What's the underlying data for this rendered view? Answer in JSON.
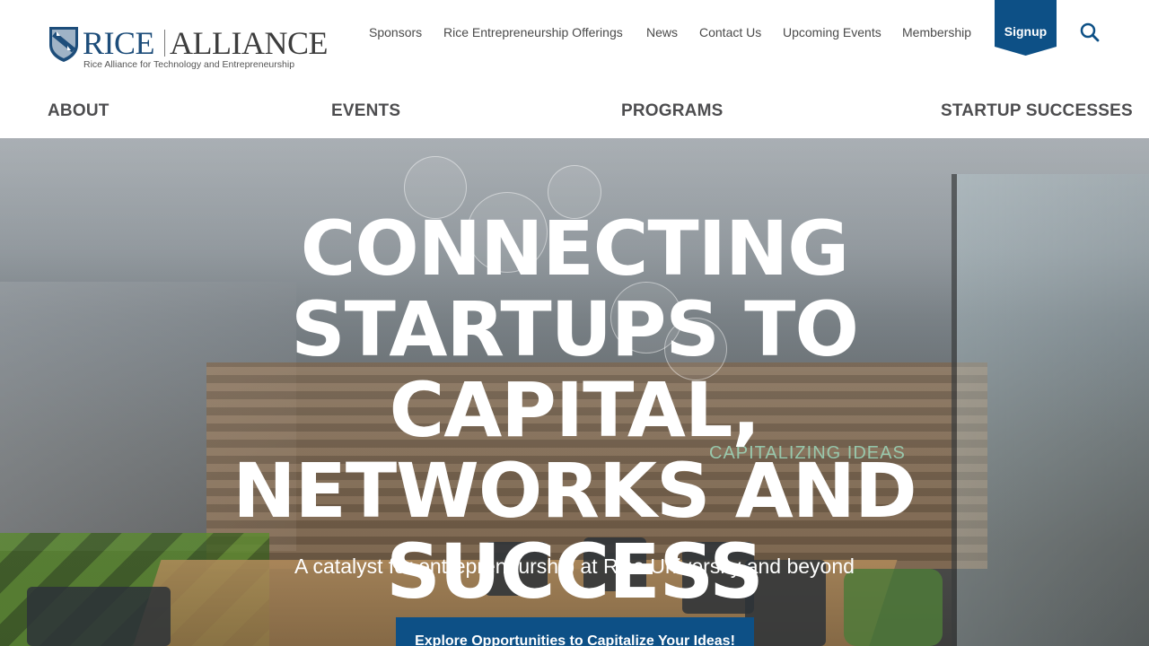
{
  "brand": {
    "name_part1": "RICE",
    "name_part2": "ALLIANCE",
    "tagline": "Rice Alliance for Technology and Entrepreneurship"
  },
  "utility_nav": {
    "items": [
      "Sponsors",
      "Rice Entrepreneurship Offerings",
      "News",
      "Contact Us",
      "Upcoming Events",
      "Membership"
    ],
    "signup_label": "Signup"
  },
  "main_nav": {
    "items": [
      "ABOUT",
      "EVENTS",
      "PROGRAMS",
      "STARTUP SUCCESSES"
    ]
  },
  "hero": {
    "title_lines": [
      "CONNECTING",
      "STARTUPS TO CAPITAL,",
      "NETWORKS AND",
      "SUCCESS"
    ],
    "subtitle": "A catalyst for entrepreneurship at Rice University and beyond",
    "cta_label": "Explore Opportunities to Capitalize Your Ideas!",
    "background_sign": "CAPITALIZING IDEAS"
  },
  "colors": {
    "brand_blue": "#0d5086",
    "nav_text": "#4d4d4f",
    "logo_blue": "#1d4d7a"
  },
  "icons": {
    "search": "search-icon",
    "shield": "shield-icon"
  }
}
